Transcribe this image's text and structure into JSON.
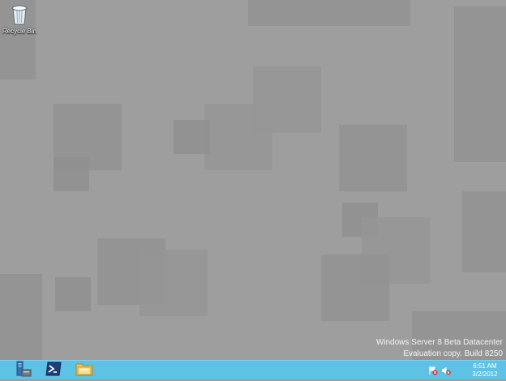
{
  "desktop": {
    "icons": [
      {
        "label": "Recycle Bin",
        "icon": "recycle-bin-icon"
      }
    ],
    "watermark": {
      "line1": "Windows Server 8 Beta Datacenter",
      "line2": "Evaluation copy. Build 8250"
    }
  },
  "taskbar": {
    "buttons": [
      {
        "icon": "server-manager-icon"
      },
      {
        "icon": "powershell-icon"
      },
      {
        "icon": "file-explorer-icon"
      }
    ],
    "tray": {
      "icons": [
        "action-center-flag-icon",
        "volume-muted-icon"
      ],
      "time": "6:51 AM",
      "date": "3/2/2012"
    }
  },
  "colors": {
    "desktop_bg": "#9e9e9e",
    "taskbar_bg": "#5ec2e6"
  }
}
